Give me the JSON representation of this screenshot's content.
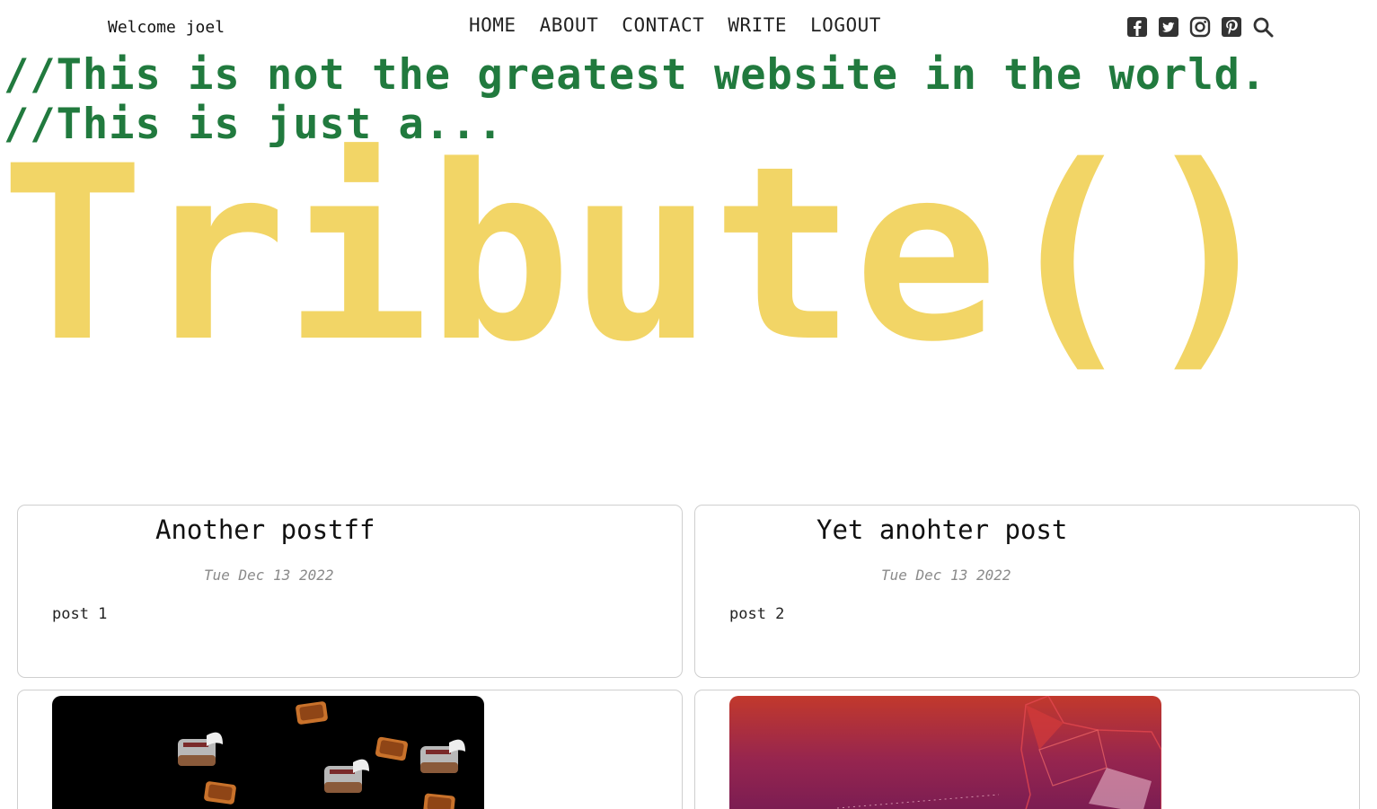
{
  "header": {
    "welcome": "Welcome joel",
    "nav": [
      "HOME",
      "ABOUT",
      "CONTACT",
      "WRITE",
      "LOGOUT"
    ],
    "social_icons": [
      "facebook-icon",
      "twitter-icon",
      "instagram-icon",
      "pinterest-icon",
      "search-icon"
    ]
  },
  "hero": {
    "line1": "//This is not the greatest website in the world.",
    "line2": "//This is just a...",
    "title": "Tribute()"
  },
  "colors": {
    "tagline": "#217a3e",
    "title": "#f2d566"
  },
  "posts": [
    {
      "title": "Another postff",
      "date": "Tue Dec 13 2022",
      "body": "post 1"
    },
    {
      "title": "Yet anohter post",
      "date": "Tue Dec 13 2022",
      "body": "post 2"
    }
  ],
  "image_posts": [
    {
      "image": "flying-toasters-image"
    },
    {
      "image": "ubuntu-wallpaper-image"
    }
  ]
}
